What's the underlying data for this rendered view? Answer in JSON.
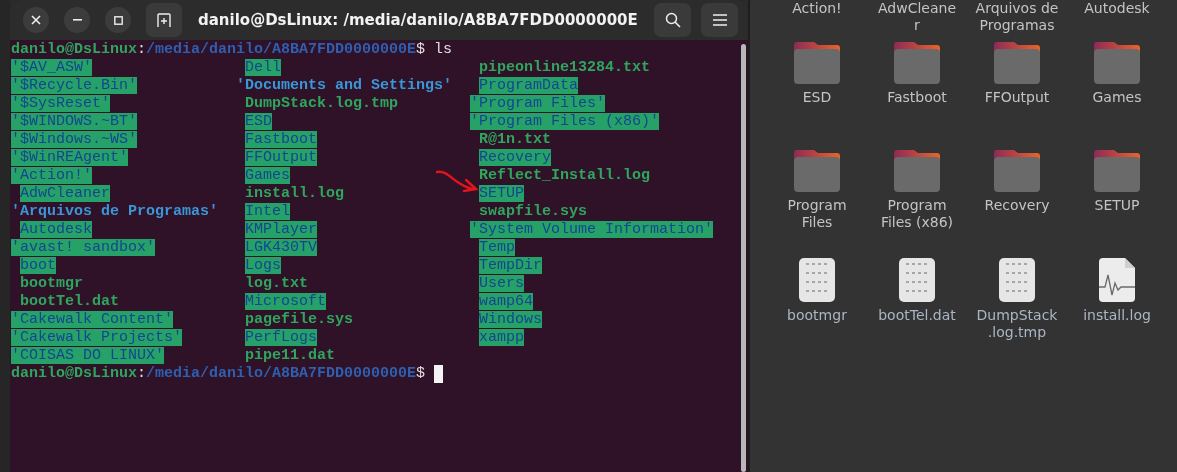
{
  "window": {
    "title": "danilo@DsLinux: /media/danilo/A8BA7FDD0000000E"
  },
  "terminal": {
    "prompt": {
      "user_host": "danilo@DsLinux",
      "separator": ":",
      "path": "/media/danilo/A8BA7FDD0000000E",
      "symbol": "$"
    },
    "command": "ls",
    "columns": [
      [
        {
          "name": "'$AV_ASW'",
          "kind": "ow-dir",
          "quoted": true
        },
        {
          "name": "'$Recycle.Bin'",
          "kind": "ow-dir",
          "quoted": true
        },
        {
          "name": "'$SysReset'",
          "kind": "ow-dir",
          "quoted": true
        },
        {
          "name": "'$WINDOWS.~BT'",
          "kind": "ow-dir",
          "quoted": true
        },
        {
          "name": "'$Windows.~WS'",
          "kind": "ow-dir",
          "quoted": true
        },
        {
          "name": "'$WinREAgent'",
          "kind": "ow-dir",
          "quoted": true
        },
        {
          "name": "'Action!'",
          "kind": "ow-dir",
          "quoted": true
        },
        {
          "name": "AdwCleaner",
          "kind": "ow-dir",
          "quoted": false
        },
        {
          "name": "'Arquivos de Programas'",
          "kind": "link",
          "quoted": true
        },
        {
          "name": "Autodesk",
          "kind": "ow-dir",
          "quoted": false
        },
        {
          "name": "'avast! sandbox'",
          "kind": "ow-dir",
          "quoted": true
        },
        {
          "name": "boot",
          "kind": "ow-dir",
          "quoted": false
        },
        {
          "name": "bootmgr",
          "kind": "file",
          "quoted": false
        },
        {
          "name": "bootTel.dat",
          "kind": "file",
          "quoted": false
        },
        {
          "name": "'Cakewalk Content'",
          "kind": "ow-dir",
          "quoted": true
        },
        {
          "name": "'Cakewalk Projects'",
          "kind": "ow-dir",
          "quoted": true
        },
        {
          "name": "'COISAS DO LINUX'",
          "kind": "ow-dir",
          "quoted": true
        }
      ],
      [
        {
          "name": "Dell",
          "kind": "ow-dir",
          "quoted": false
        },
        {
          "name": "'Documents and Settings'",
          "kind": "link",
          "quoted": true
        },
        {
          "name": "DumpStack.log.tmp",
          "kind": "file",
          "quoted": false
        },
        {
          "name": "ESD",
          "kind": "ow-dir",
          "quoted": false
        },
        {
          "name": "Fastboot",
          "kind": "ow-dir",
          "quoted": false
        },
        {
          "name": "FFOutput",
          "kind": "ow-dir",
          "quoted": false
        },
        {
          "name": "Games",
          "kind": "ow-dir",
          "quoted": false
        },
        {
          "name": "install.log",
          "kind": "file",
          "quoted": false
        },
        {
          "name": "Intel",
          "kind": "ow-dir",
          "quoted": false
        },
        {
          "name": "KMPlayer",
          "kind": "ow-dir",
          "quoted": false
        },
        {
          "name": "LGK430TV",
          "kind": "ow-dir",
          "quoted": false
        },
        {
          "name": "Logs",
          "kind": "ow-dir",
          "quoted": false
        },
        {
          "name": "log.txt",
          "kind": "file",
          "quoted": false
        },
        {
          "name": "Microsoft",
          "kind": "ow-dir",
          "quoted": false
        },
        {
          "name": "pagefile.sys",
          "kind": "file",
          "quoted": false
        },
        {
          "name": "PerfLogs",
          "kind": "ow-dir",
          "quoted": false
        },
        {
          "name": "pipe11.dat",
          "kind": "file",
          "quoted": false
        }
      ],
      [
        {
          "name": "pipeonline13284.txt",
          "kind": "file",
          "quoted": false
        },
        {
          "name": "ProgramData",
          "kind": "ow-dir",
          "quoted": false
        },
        {
          "name": "'Program Files'",
          "kind": "ow-dir",
          "quoted": true
        },
        {
          "name": "'Program Files (x86)'",
          "kind": "ow-dir",
          "quoted": true
        },
        {
          "name": "R@1n.txt",
          "kind": "file",
          "quoted": false
        },
        {
          "name": "Recovery",
          "kind": "ow-dir",
          "quoted": false
        },
        {
          "name": "Reflect_Install.log",
          "kind": "file",
          "quoted": false
        },
        {
          "name": "SETUP",
          "kind": "ow-dir",
          "quoted": false
        },
        {
          "name": "swapfile.sys",
          "kind": "file",
          "quoted": false
        },
        {
          "name": "'System Volume Information'",
          "kind": "ow-dir",
          "quoted": true
        },
        {
          "name": "Temp",
          "kind": "ow-dir",
          "quoted": false
        },
        {
          "name": "TempDir",
          "kind": "ow-dir",
          "quoted": false
        },
        {
          "name": "Users",
          "kind": "ow-dir",
          "quoted": false
        },
        {
          "name": "wamp64",
          "kind": "ow-dir",
          "quoted": false
        },
        {
          "name": "Windows",
          "kind": "ow-dir",
          "quoted": false
        },
        {
          "name": "xampp",
          "kind": "ow-dir",
          "quoted": false
        }
      ]
    ],
    "final_prompt": {
      "user_host": "danilo@DsLinux",
      "separator": ":",
      "path": "/media/danilo/A8BA7FDD0000000E",
      "symbol": "$",
      "cursor": true
    }
  },
  "file_manager": {
    "cut_labels": [
      {
        "lines": [
          "Action!"
        ]
      },
      {
        "lines": [
          "AdwCleane",
          "r"
        ]
      },
      {
        "lines": [
          "Arquivos de",
          "Programas"
        ]
      },
      {
        "lines": [
          "Autodesk"
        ]
      }
    ],
    "items": [
      {
        "kind": "folder",
        "lines": [
          "ESD"
        ]
      },
      {
        "kind": "folder",
        "lines": [
          "Fastboot"
        ]
      },
      {
        "kind": "folder",
        "lines": [
          "FFOutput"
        ]
      },
      {
        "kind": "folder",
        "lines": [
          "Games"
        ]
      },
      {
        "kind": "folder",
        "lines": [
          "Program",
          "Files"
        ]
      },
      {
        "kind": "folder",
        "lines": [
          "Program",
          "Files (x86)"
        ]
      },
      {
        "kind": "folder",
        "lines": [
          "Recovery"
        ]
      },
      {
        "kind": "folder",
        "lines": [
          "SETUP"
        ]
      },
      {
        "kind": "binary",
        "lines": [
          "bootmgr"
        ]
      },
      {
        "kind": "binary",
        "lines": [
          "bootTel.dat"
        ]
      },
      {
        "kind": "binary",
        "lines": [
          "DumpStack",
          ".log.tmp"
        ]
      },
      {
        "kind": "log",
        "lines": [
          "install.log"
        ]
      }
    ]
  }
}
